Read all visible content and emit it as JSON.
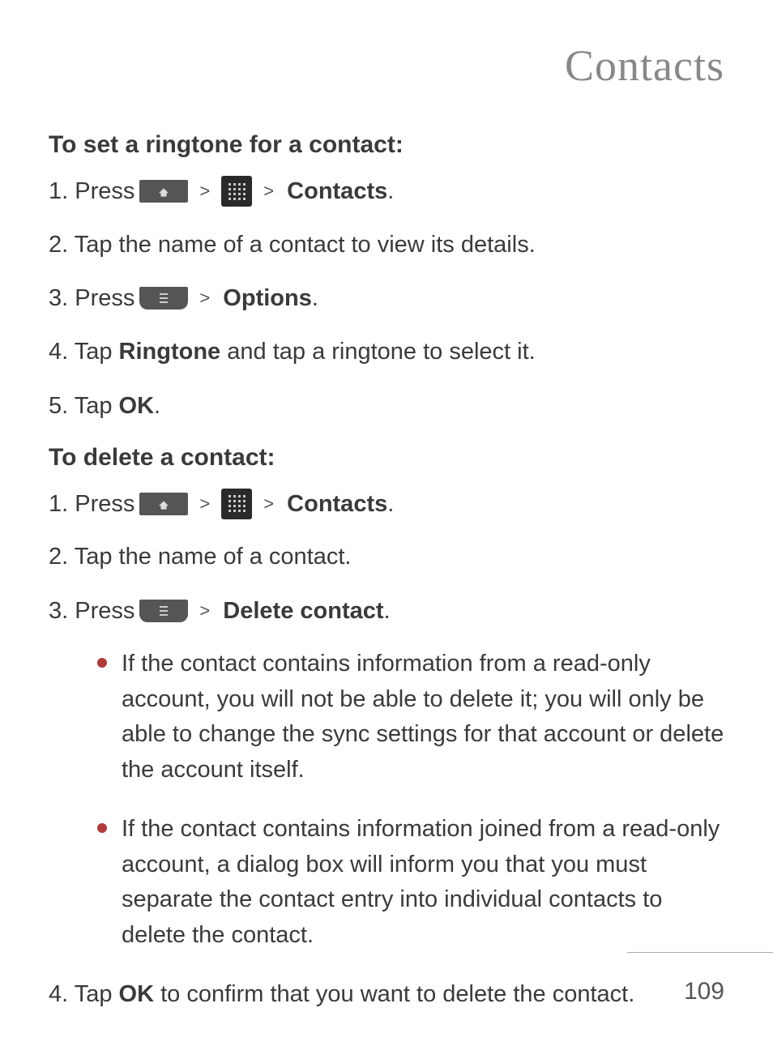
{
  "page_title": "Contacts",
  "section1": {
    "heading": "To set a ringtone for a contact:",
    "steps": {
      "s1_prefix": "1. Press ",
      "s1_contacts": "Contacts",
      "s1_suffix": ".",
      "s2": "2. Tap the name of a contact to view its details.",
      "s3_prefix": "3. Press ",
      "s3_options": "Options",
      "s3_suffix": ".",
      "s4_prefix": "4. Tap ",
      "s4_bold": "Ringtone",
      "s4_suffix": " and tap a ringtone to select it.",
      "s5_prefix": "5. Tap ",
      "s5_bold": "OK",
      "s5_suffix": "."
    }
  },
  "section2": {
    "heading": "To delete a contact:",
    "steps": {
      "s1_prefix": "1. Press ",
      "s1_contacts": "Contacts",
      "s1_suffix": ".",
      "s2": "2. Tap the name of a contact.",
      "s3_prefix": "3. Press ",
      "s3_delete": "Delete contact",
      "s3_suffix": ".",
      "bullet1": "If the contact contains information from a read-only account, you will not be able to delete it; you will only be able to change the sync settings for that account or delete the account itself.",
      "bullet2": "If the contact contains information joined from a read-only account, a dialog box will inform you that you must separate the contact entry into individual contacts to delete the contact.",
      "s4_prefix": "4. Tap ",
      "s4_bold": "OK",
      "s4_suffix": " to confirm that you want to delete the contact."
    }
  },
  "page_number": "109",
  "separators": {
    "gt": ">"
  }
}
